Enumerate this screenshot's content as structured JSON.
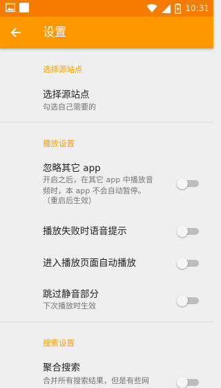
{
  "status_bar": {
    "time": "10:31",
    "icons": [
      "image-icon",
      "square-icon",
      "wifi-icon",
      "signal-icon",
      "battery-charging-icon"
    ]
  },
  "app_bar": {
    "title": "设置",
    "back_icon": "arrow-left-icon"
  },
  "colors": {
    "accent": "#ff9800",
    "status_bar": "#f57c00",
    "section_header": "#ffa000",
    "background": "#efefef"
  },
  "sections": [
    {
      "header": "选择源站点",
      "items": [
        {
          "title": "选择源站点",
          "subtitle": "勾选自己需要的"
        }
      ]
    },
    {
      "header": "播放设置",
      "items": [
        {
          "title": "忽略其它 app",
          "subtitle_lines": [
            "开启之后，在其它 app 中播放音",
            "频时，本 app 不会自动暂停。",
            "（重启后生效）"
          ],
          "toggle": false
        },
        {
          "title": "播放失败时语音提示",
          "toggle": false
        },
        {
          "title": "进入播放页面自动播放",
          "toggle": false
        },
        {
          "title": "跳过静音部分",
          "subtitle": "下次播放时生效",
          "toggle": false
        }
      ]
    },
    {
      "header": "搜索设置",
      "items": [
        {
          "title": "聚合搜索",
          "subtitle": "合并所有搜索结果，但是有些网",
          "toggle": false
        }
      ]
    }
  ]
}
